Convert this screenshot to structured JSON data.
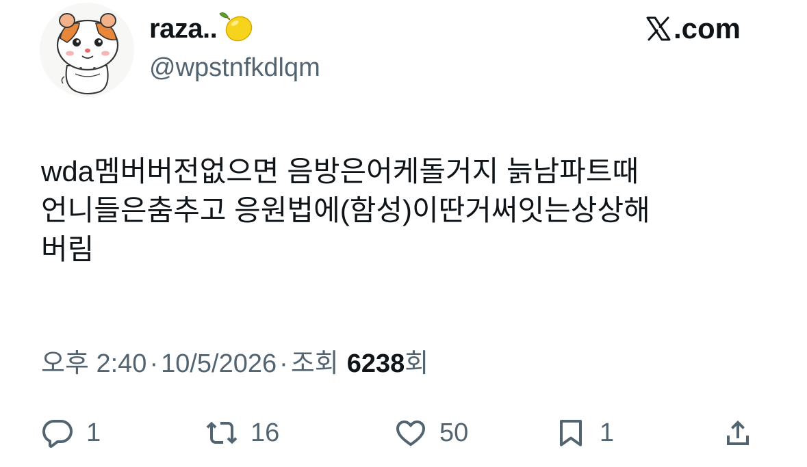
{
  "author": {
    "display_name": "raza..",
    "emoji_icon": "lemon-icon",
    "handle": "@wpstnfkdlqm",
    "avatar_icon": "hamster-avatar"
  },
  "source": {
    "label": ".com",
    "logo_icon": "x-logo-icon"
  },
  "tweet": {
    "lines": [
      "wda멤버버전없으면 음방은어케돌거지 늙남파트때",
      "언니들은춤추고 응원법에(함성)이딴거써잇는상상해",
      "버림"
    ]
  },
  "meta": {
    "time": "오후 2:40",
    "separator": "·",
    "date": "10/5/2026",
    "views_label": "조회",
    "views_count": "6238",
    "views_suffix": "회"
  },
  "actions": {
    "reply": {
      "icon": "reply-icon",
      "count": "1"
    },
    "retweet": {
      "icon": "retweet-icon",
      "count": "16"
    },
    "like": {
      "icon": "heart-icon",
      "count": "50"
    },
    "bookmark": {
      "icon": "bookmark-icon",
      "count": "1"
    },
    "share": {
      "icon": "share-icon"
    }
  },
  "colors": {
    "text": "#0f1419",
    "secondary": "#536471",
    "background": "#ffffff"
  }
}
